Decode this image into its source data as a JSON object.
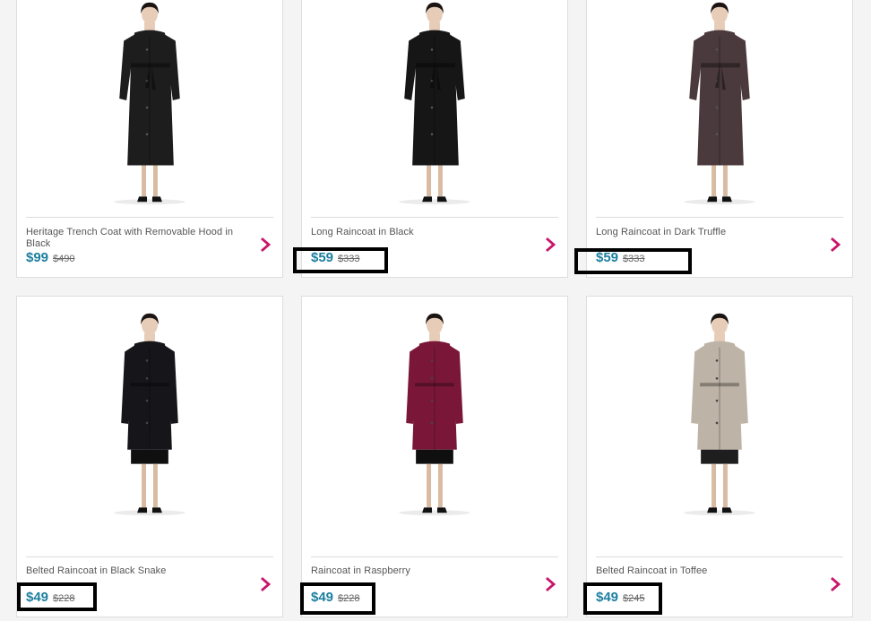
{
  "colors": {
    "price": "#1c7fa0",
    "chevron": "#c8166a",
    "highlight": "#000000"
  },
  "products": [
    {
      "name": "Heritage Trench Coat with Removable Hood in Black",
      "price": "$99",
      "original_price": "$490",
      "coat_color": "#1d1d1d",
      "style": "trench",
      "highlighted": false
    },
    {
      "name": "Long Raincoat in Black",
      "price": "$59",
      "original_price": "$333",
      "coat_color": "#161616",
      "style": "long",
      "highlighted": true
    },
    {
      "name": "Long Raincoat in Dark Truffle",
      "price": "$59",
      "original_price": "$333",
      "coat_color": "#4a3a3d",
      "style": "long",
      "highlighted": true
    },
    {
      "name": "Belted Raincoat in Black Snake",
      "price": "$49",
      "original_price": "$228",
      "coat_color": "#15151a",
      "style": "short",
      "highlighted": true
    },
    {
      "name": "Raincoat in Raspberry",
      "price": "$49",
      "original_price": "$228",
      "coat_color": "#7a1738",
      "style": "short",
      "highlighted": true
    },
    {
      "name": "Belted Raincoat in Toffee",
      "price": "$49",
      "original_price": "$245",
      "coat_color": "#bdb3a6",
      "style": "short-light",
      "highlighted": true
    }
  ]
}
